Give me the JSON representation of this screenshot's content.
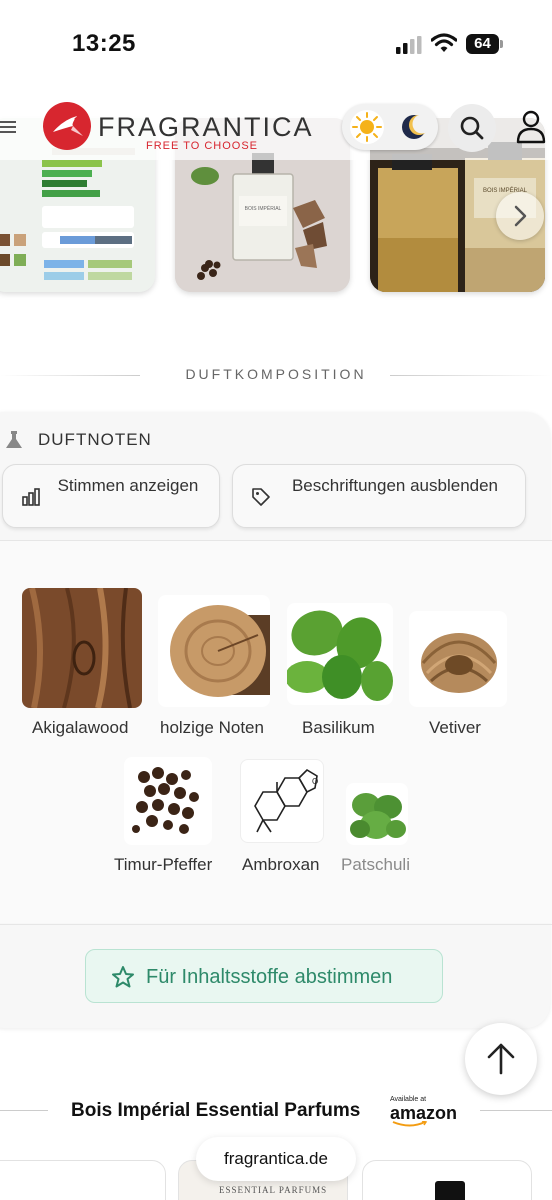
{
  "status_bar": {
    "time": "13:25",
    "battery": "64"
  },
  "header": {
    "brand": "FRAGRANTICA",
    "tagline": "FREE TO CHOOSE"
  },
  "carousel": {
    "thumb2_label": "BOIS IMPÉRIAL",
    "thumb3_label": "BOIS IMPÉRIAL"
  },
  "section": {
    "title": "DUFTKOMPOSITION"
  },
  "notes": {
    "title": "DUFTNOTEN",
    "votes_button": "Stimmen anzeigen",
    "labels_button": "Beschriftungen ausblenden",
    "items": [
      {
        "label": "Akigalawood"
      },
      {
        "label": "holzige Noten"
      },
      {
        "label": "Basilikum"
      },
      {
        "label": "Vetiver"
      },
      {
        "label": "Timur-Pfeffer"
      },
      {
        "label": "Ambroxan"
      },
      {
        "label": "Patschuli"
      }
    ],
    "vote_ingredients_button": "Für Inhaltsstoffe abstimmen"
  },
  "bottom": {
    "title": "Bois Impérial Essential Parfums",
    "amazon_small": "Available at",
    "amazon_logo": "amazon",
    "card_label": "ESSENTIAL PARFUMS"
  },
  "url_bar": {
    "domain": "fragrantica.de"
  },
  "colors": {
    "brand_red": "#d7262f",
    "accent_green": "#2e8a6a"
  }
}
